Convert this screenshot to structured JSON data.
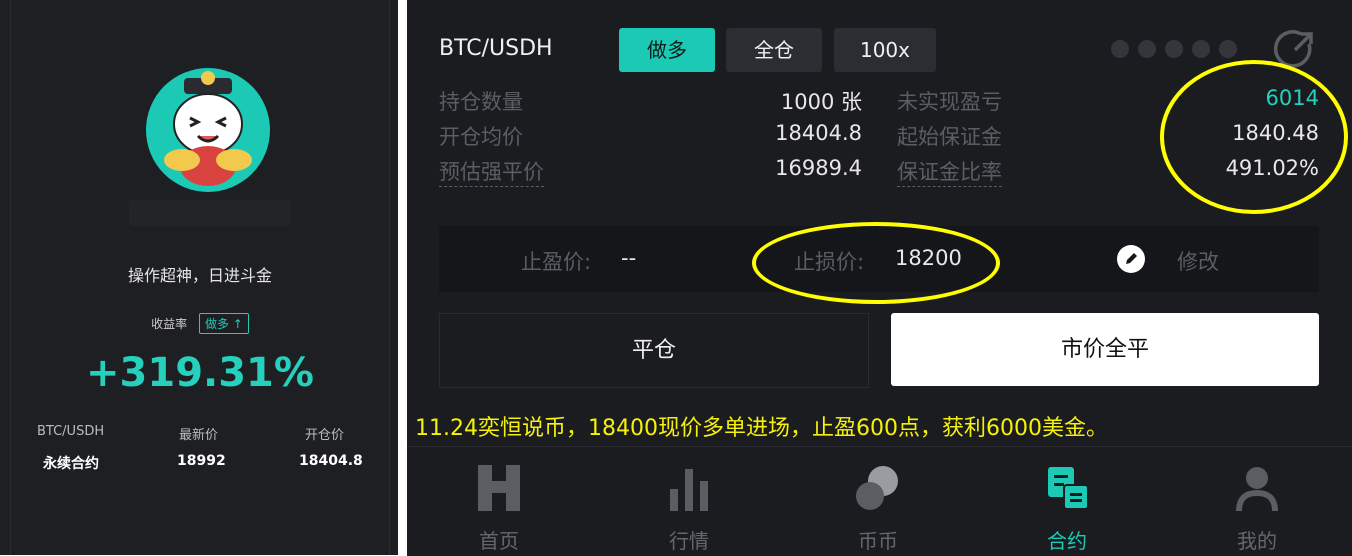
{
  "left": {
    "slogan": "操作超神，日进斗金",
    "yield_label": "收益率",
    "direction_badge": "做多 ↑",
    "yield_value": "+319.31%",
    "stats": {
      "pair_label": "BTC/USDH",
      "pair_value": "永续合约",
      "last_label": "最新价",
      "last_value": "18992",
      "open_label": "开仓价",
      "open_value": "18404.8"
    }
  },
  "position": {
    "pair": "BTC/USDH",
    "side": "做多",
    "margin_mode": "全仓",
    "leverage": "100x",
    "rows": [
      {
        "label_left": "持仓数量",
        "value_left": "1000 张",
        "label_right": "未实现盈亏",
        "value_right": "6014"
      },
      {
        "label_left": "开仓均价",
        "value_left": "18404.8",
        "label_right": "起始保证金",
        "value_right": "1840.48"
      },
      {
        "label_left": "预估强平价",
        "value_left": "16989.4",
        "label_right": "保证金比率",
        "value_right": "491.02%"
      }
    ],
    "take_profit_label": "止盈价:",
    "take_profit_value": "--",
    "stop_loss_label": "止损价:",
    "stop_loss_value": "18200",
    "edit_label": "修改",
    "close_button": "平仓",
    "market_close_button": "市价全平"
  },
  "caption": "11.24奕恒说币，18400现价多单进场，止盈600点，获利6000美金。",
  "nav": [
    {
      "label": "首页",
      "icon": "home-h-icon"
    },
    {
      "label": "行情",
      "icon": "bar-chart-icon"
    },
    {
      "label": "币币",
      "icon": "coins-icon"
    },
    {
      "label": "合约",
      "icon": "contract-icon",
      "active": true
    },
    {
      "label": "我的",
      "icon": "user-icon"
    }
  ],
  "colors": {
    "accent": "#1cc9b5",
    "annotation": "#f5f10a",
    "profit": "#25d1bd"
  }
}
